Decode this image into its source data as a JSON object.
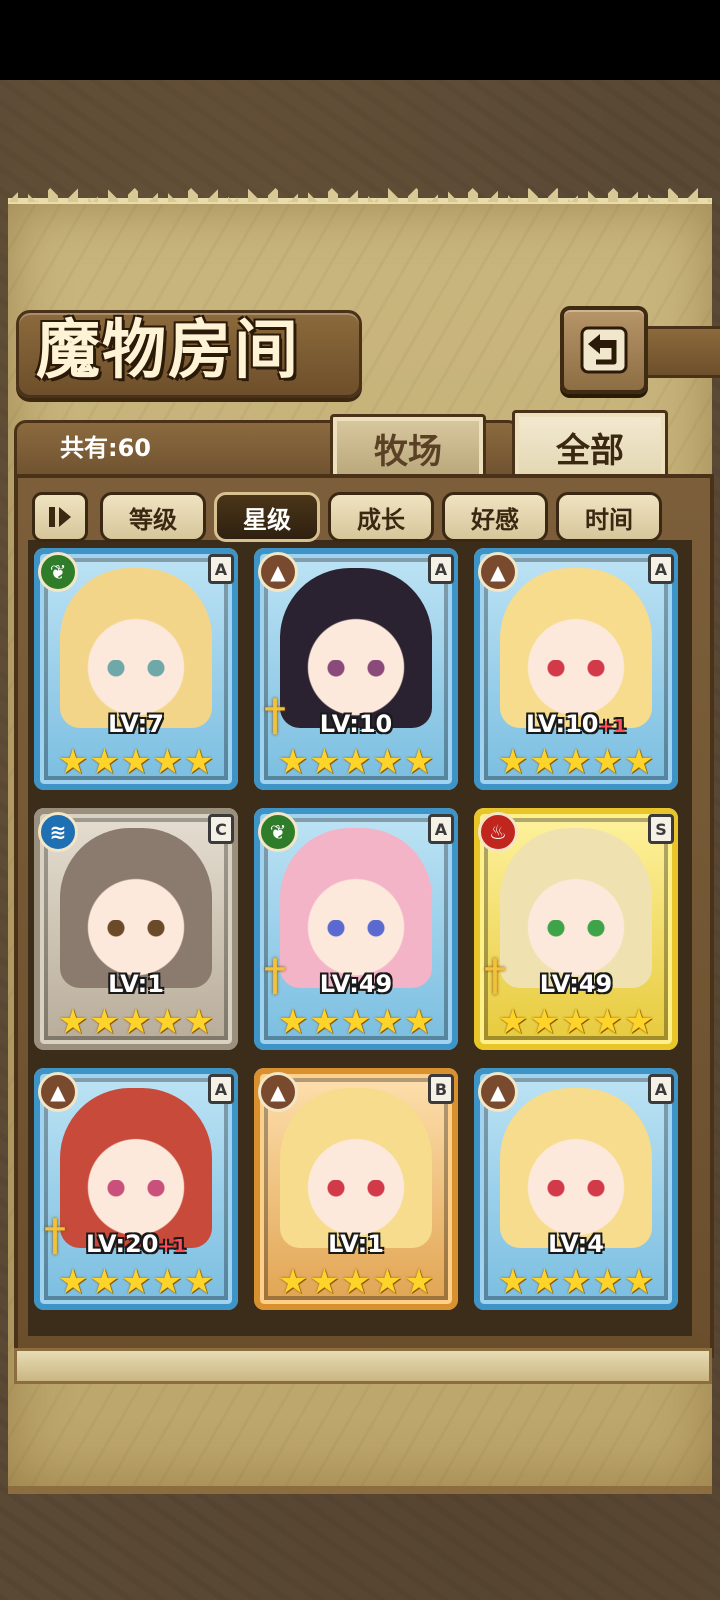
{
  "header": {
    "title": "魔物房间",
    "back_icon": "return-arrow-icon"
  },
  "count": {
    "label": "共有:60"
  },
  "tabs": [
    {
      "label": "牧场",
      "active": false
    },
    {
      "label": "全部",
      "active": true
    }
  ],
  "sort": {
    "toggle_icon": "sort-direction-icon",
    "buttons": [
      {
        "label": "等级",
        "active": false
      },
      {
        "label": "星级",
        "active": true
      },
      {
        "label": "成长",
        "active": false
      },
      {
        "label": "好感",
        "active": false
      },
      {
        "label": "时间",
        "active": false
      }
    ]
  },
  "monsters": [
    {
      "level": "LV:7",
      "plus": "",
      "rank": "A",
      "element": "leaf",
      "elem_color": "#2f7d2a",
      "frame": "blue",
      "stars": 5,
      "weapon": false
    },
    {
      "level": "LV:10",
      "plus": "",
      "rank": "A",
      "element": "rock",
      "elem_color": "#7a4a2e",
      "frame": "blue",
      "stars": 5,
      "weapon": true
    },
    {
      "level": "LV:10",
      "plus": "+1",
      "rank": "A",
      "element": "rock",
      "elem_color": "#7a4a2e",
      "frame": "blue",
      "stars": 5,
      "weapon": false
    },
    {
      "level": "LV:1",
      "plus": "",
      "rank": "C",
      "element": "water",
      "elem_color": "#1f6fb3",
      "frame": "gray",
      "stars": 5,
      "weapon": false
    },
    {
      "level": "LV:49",
      "plus": "",
      "rank": "A",
      "element": "leaf",
      "elem_color": "#2f7d2a",
      "frame": "blue",
      "stars": 5,
      "weapon": true
    },
    {
      "level": "LV:49",
      "plus": "",
      "rank": "S",
      "element": "fire",
      "elem_color": "#c0261d",
      "frame": "gold",
      "stars": 5,
      "weapon": true
    },
    {
      "level": "LV:20",
      "plus": "+1",
      "rank": "A",
      "element": "rock",
      "elem_color": "#7a4a2e",
      "frame": "blue",
      "stars": 5,
      "weapon": true
    },
    {
      "level": "LV:1",
      "plus": "",
      "rank": "B",
      "element": "rock",
      "elem_color": "#7a4a2e",
      "frame": "orange",
      "stars": 5,
      "weapon": false
    },
    {
      "level": "LV:4",
      "plus": "",
      "rank": "A",
      "element": "rock",
      "elem_color": "#7a4a2e",
      "frame": "blue",
      "stars": 5,
      "weapon": false
    }
  ],
  "colors": {
    "panel": "#c9b67e",
    "frame_blue": "#3f94c7",
    "frame_gold": "#e8c62a",
    "frame_orange": "#d9902f",
    "frame_gray": "#9b8f7e",
    "star": "#ffd42a"
  }
}
